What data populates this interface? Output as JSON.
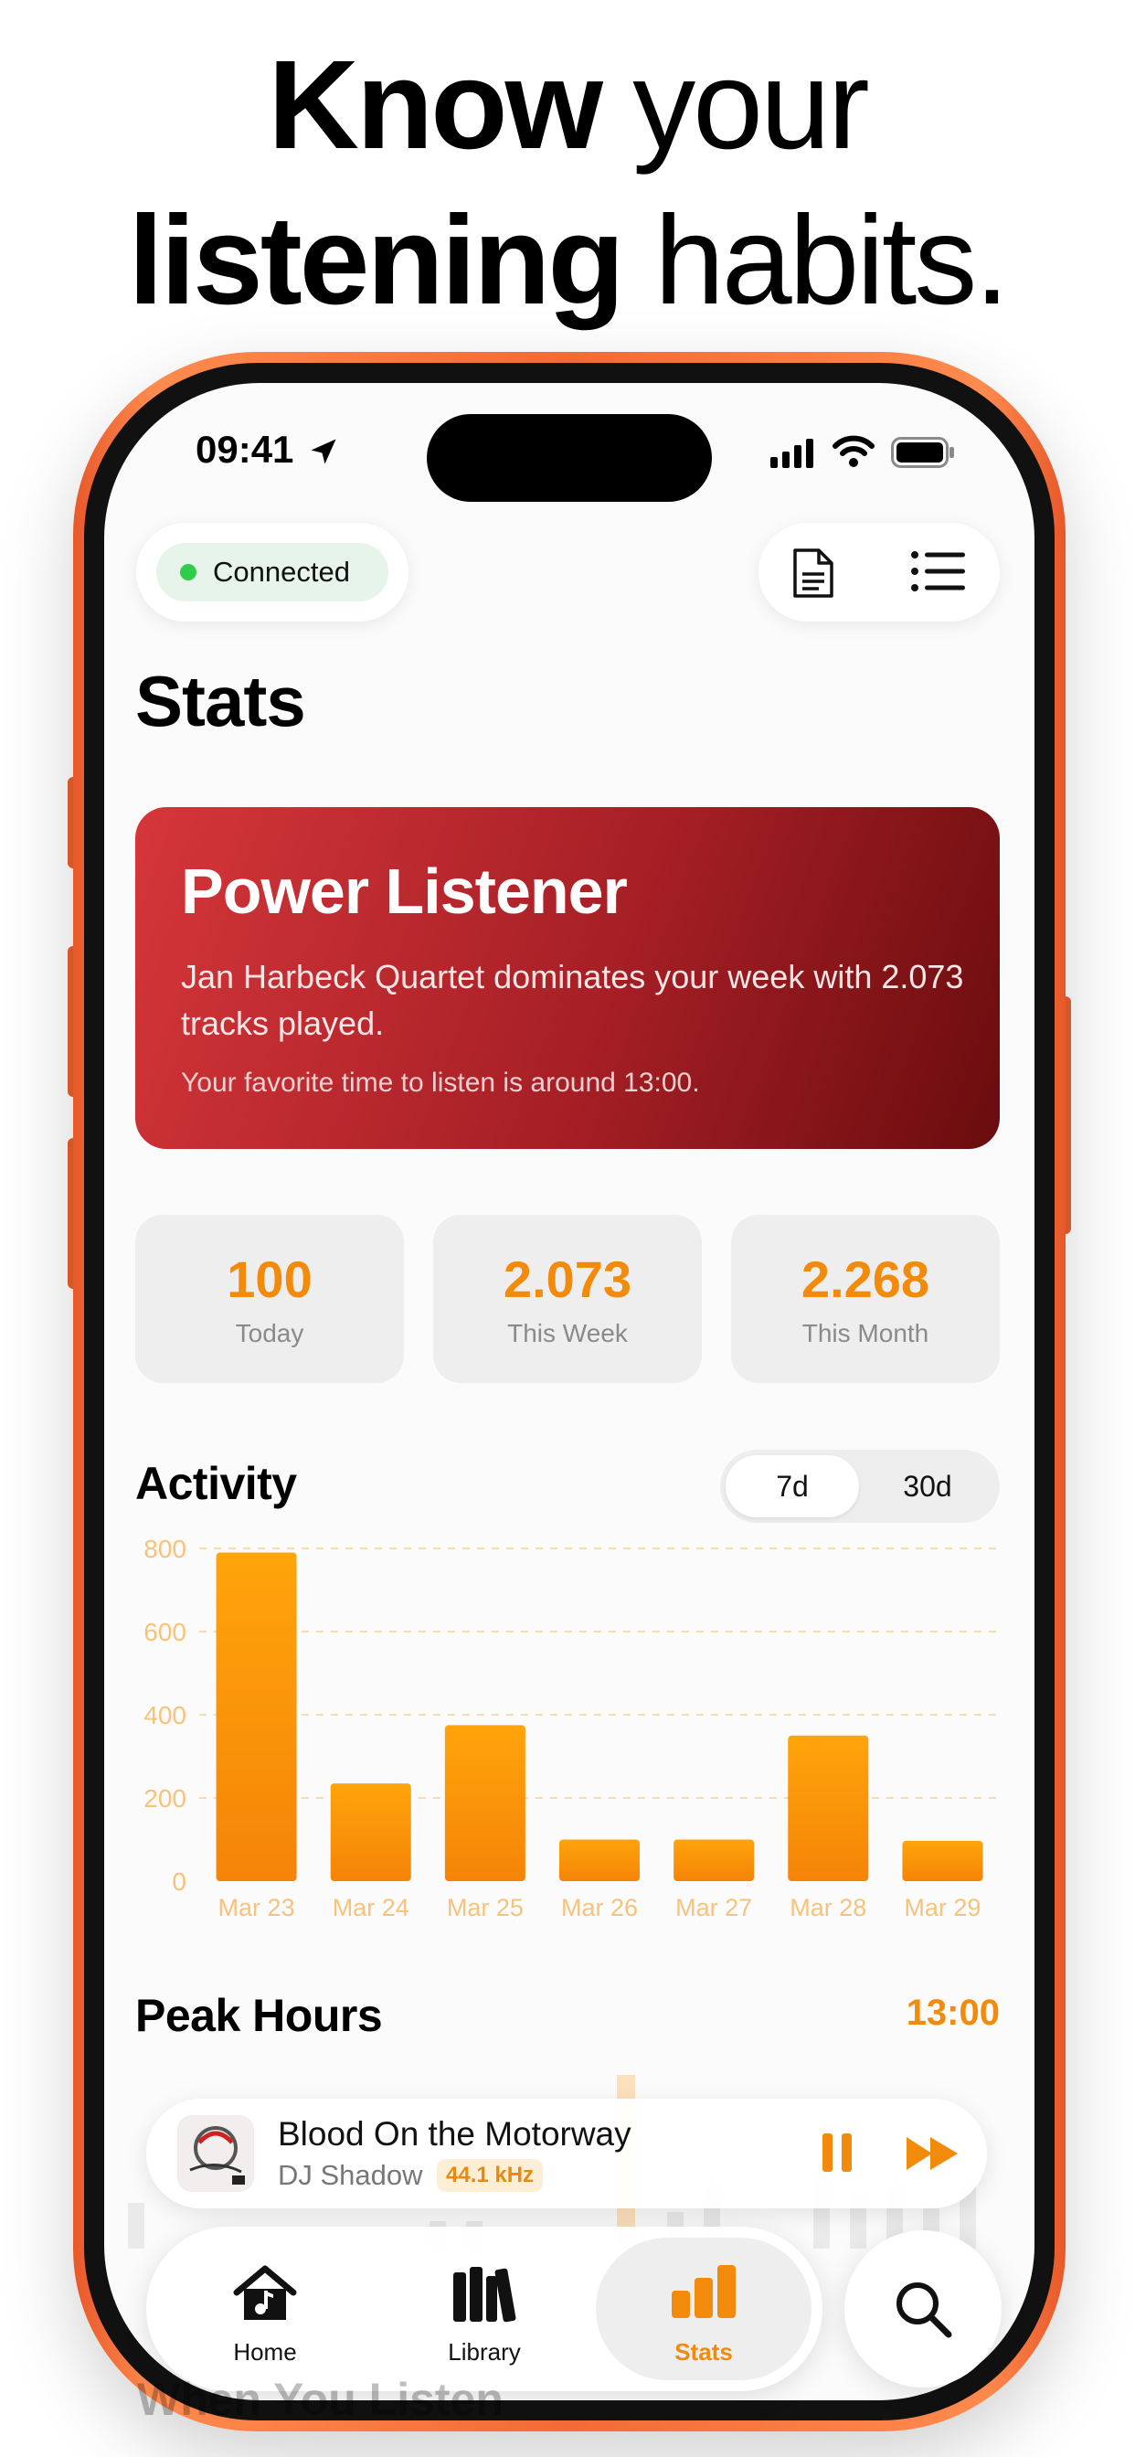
{
  "headline": {
    "line1_bold": "Know",
    "line1_light": "your",
    "line2_bold": "listening",
    "line2_light": "habits."
  },
  "status_bar": {
    "time": "09:41",
    "icons": [
      "location-arrow-icon",
      "cellular-signal-icon",
      "wifi-icon",
      "battery-icon"
    ]
  },
  "top_bar": {
    "connection_label": "Connected",
    "connection_color": "#2ecc4a",
    "actions": [
      "document-icon",
      "list-icon"
    ]
  },
  "page": {
    "title": "Stats"
  },
  "hero": {
    "title": "Power Listener",
    "text": "Jan Harbeck Quartet dominates your week with 2.073 tracks played.",
    "note": "Your favorite time to listen is around 13:00."
  },
  "stats": [
    {
      "value": "100",
      "label": "Today"
    },
    {
      "value": "2.073",
      "label": "This Week"
    },
    {
      "value": "2.268",
      "label": "This Month"
    }
  ],
  "activity": {
    "title": "Activity",
    "ranges": [
      "7d",
      "30d"
    ],
    "selected_range": "7d"
  },
  "chart_data": {
    "type": "bar",
    "categories": [
      "Mar 23",
      "Mar 24",
      "Mar 25",
      "Mar 26",
      "Mar 27",
      "Mar 28",
      "Mar 29"
    ],
    "values": [
      790,
      235,
      375,
      100,
      100,
      350,
      97
    ],
    "yticks": [
      0,
      200,
      400,
      600,
      800
    ],
    "ylim": [
      0,
      800
    ],
    "grid": true,
    "bar_color_top": "#ffa40a",
    "bar_color_bottom": "#f58408"
  },
  "peak_hours": {
    "title": "Peak Hours",
    "value": "13:00"
  },
  "now_playing": {
    "title": "Blood On the Motorway",
    "artist": "DJ Shadow",
    "quality": "44.1 kHz",
    "controls": [
      "pause-icon",
      "fast-forward-icon"
    ]
  },
  "tabs": [
    {
      "label": "Home",
      "icon": "home-music-icon"
    },
    {
      "label": "Library",
      "icon": "library-icon"
    },
    {
      "label": "Stats",
      "icon": "stats-bars-icon"
    }
  ],
  "selected_tab": "Stats",
  "next_section_peek": "When You Listen",
  "accent_color": "#f28a0c"
}
